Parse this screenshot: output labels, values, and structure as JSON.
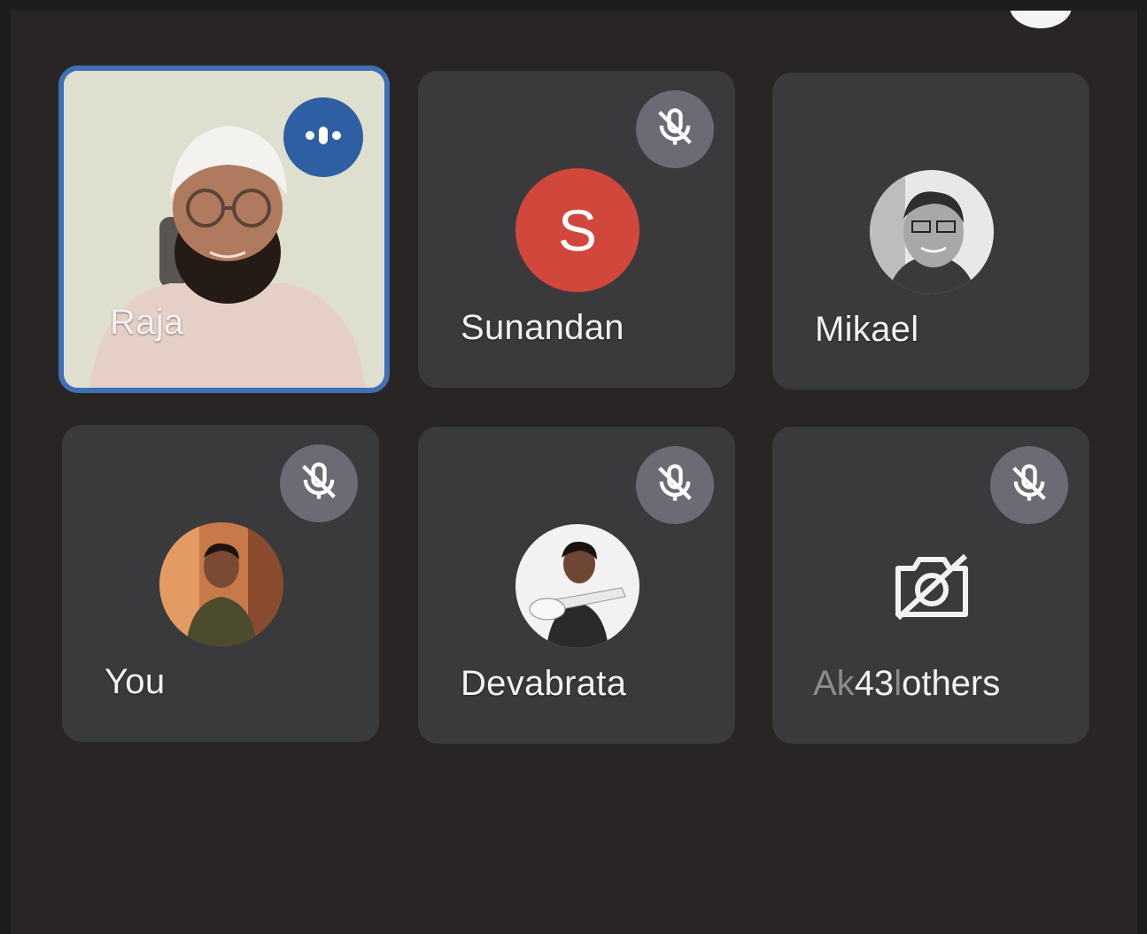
{
  "colors": {
    "tile_bg": "#3a3a3c",
    "active_border": "#3f6fb5",
    "mute_badge": "#6c6a75",
    "avatar_s": "#d2473c"
  },
  "participants": [
    {
      "name": "Raja",
      "state": "speaking",
      "icon": "audio-levels-icon"
    },
    {
      "name": "Sunandan",
      "state": "muted",
      "icon": "mic-off-icon",
      "avatar_letter": "S"
    },
    {
      "name": "Mikael",
      "state": "camera-off-photo"
    },
    {
      "name": "You",
      "state": "muted",
      "icon": "mic-off-icon"
    },
    {
      "name": "Devabrata",
      "state": "muted",
      "icon": "mic-off-icon"
    }
  ],
  "others_tile": {
    "ghost_prefix": "Ak",
    "count": "43",
    "ghost_sep": "l",
    "label": "others",
    "icon": "camera-off-icon"
  }
}
